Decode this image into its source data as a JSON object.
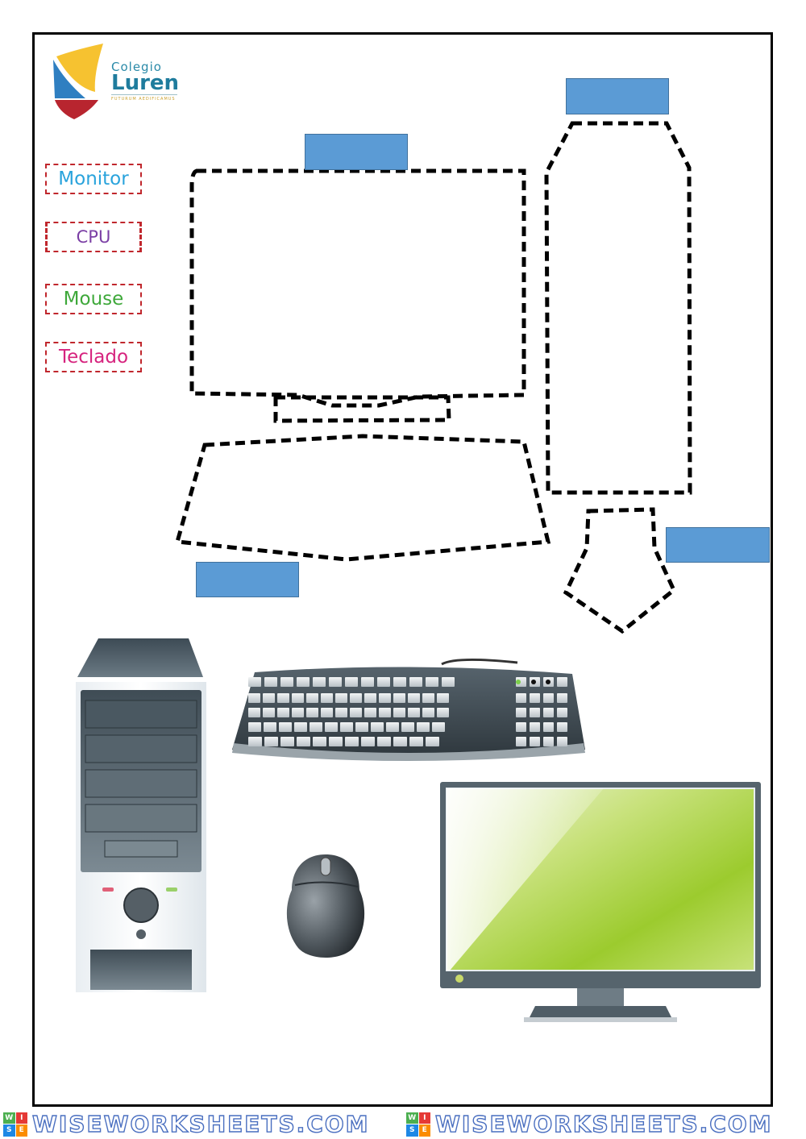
{
  "logo": {
    "line1": "Colegio",
    "line2": "Luren",
    "motto": "FUTURUM AEDIFICAMUS",
    "colors": {
      "blue": "#2f7fc1",
      "yellow": "#f6c230",
      "red": "#b8252f",
      "text": "#1f7c9d"
    }
  },
  "word_bank": [
    {
      "id": "monitor",
      "label": "Monitor",
      "color": "#29a3dc"
    },
    {
      "id": "cpu",
      "label": "CPU",
      "color": "#7b3fa5"
    },
    {
      "id": "mouse",
      "label": "Mouse",
      "color": "#3ea83a"
    },
    {
      "id": "teclado",
      "label": "Teclado",
      "color": "#d6237e"
    }
  ],
  "drop_targets": [
    {
      "id": "monitor-slot",
      "outline": "monitor"
    },
    {
      "id": "cpu-slot",
      "outline": "cpu"
    },
    {
      "id": "keyboard-slot",
      "outline": "keyboard"
    },
    {
      "id": "mouse-slot",
      "outline": "mouse"
    }
  ],
  "answer_box_color": "#5b9bd5",
  "pictures": [
    "cpu-tower",
    "keyboard",
    "mouse",
    "monitor"
  ],
  "footer": {
    "watermark": "WISEWORKSHEETS.COM",
    "badge": [
      "W",
      "I",
      "S",
      "E"
    ],
    "badge_colors": [
      "#4caf50",
      "#e53935",
      "#1e88e5",
      "#fb8c00"
    ]
  }
}
